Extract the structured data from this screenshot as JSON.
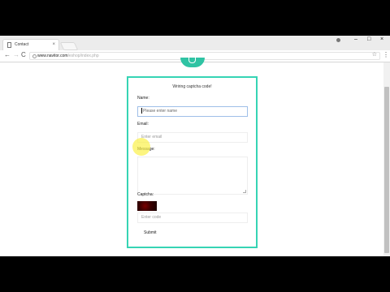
{
  "browser": {
    "tab": {
      "title": "Contact",
      "close": "×"
    },
    "window_controls": {
      "minimize": "–",
      "maximize": "□",
      "close": "×"
    },
    "nav": {
      "back": "←",
      "forward": "→",
      "reload": "C"
    },
    "address": {
      "host": "www.navitor.com",
      "path": "/eshop/index.php"
    },
    "star": "☆",
    "menu": "⋮"
  },
  "form": {
    "title": "Wriring captcha code!",
    "name_label": "Name:",
    "name_placeholder": "Please enter name",
    "email_label": "Email:",
    "email_placeholder": "Enter email",
    "message_label": "Message:",
    "captcha_label": "Captcha:",
    "captcha_placeholder": "Enter code",
    "submit_label": "Submit"
  },
  "colors": {
    "accent": "#36d4b4",
    "logo": "#2fc3a3",
    "cursor_highlight": "#faf03c"
  }
}
